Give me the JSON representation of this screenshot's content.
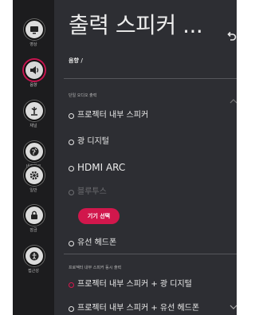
{
  "sidebar": {
    "items": [
      {
        "label": "영상",
        "icon": "picture-icon"
      },
      {
        "label": "음향",
        "icon": "sound-icon",
        "active": true
      },
      {
        "label": "채널",
        "icon": "antenna-icon"
      },
      {
        "label": "네트워크",
        "icon": "network-globe-icon"
      },
      {
        "label": "일반",
        "icon": "gear-icon"
      },
      {
        "label": "잠금",
        "icon": "lock-icon"
      },
      {
        "label": "접근성",
        "icon": "accessibility-icon"
      }
    ]
  },
  "header": {
    "title": "출력 스피커 ...",
    "breadcrumb": "음향 /",
    "back_icon": "back-arrow-icon"
  },
  "sound_output": {
    "group1_label": "단일 오디오 출력",
    "group2_label": "프로젝터 내부 스피커 동시 출력",
    "options": [
      {
        "label": "프로젝터 내부 스피커"
      },
      {
        "label": "광 디지털"
      },
      {
        "label": "HDMI ARC"
      },
      {
        "label": "블루투스",
        "disabled": true
      },
      {
        "label": "유선 헤드폰"
      }
    ],
    "combo_options": [
      {
        "label": "프로젝터 내부 스피커 + 광 디지털",
        "selected": true
      },
      {
        "label": "프로젝터 내부 스피커 + 유선 헤드폰"
      }
    ],
    "select_device_label": "기기 선택"
  },
  "colors": {
    "background": "#2d2e33",
    "sidebar": "#1c1c1e",
    "accent": "#d1174c"
  }
}
